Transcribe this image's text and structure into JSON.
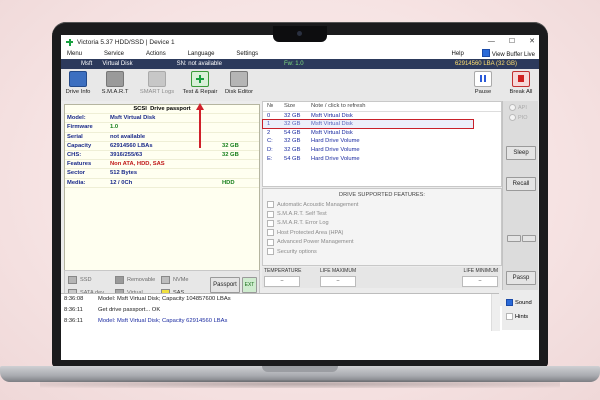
{
  "window": {
    "title": "Victoria 5.37 HDD/SSD | Device 1",
    "controls": [
      "—",
      "☐",
      "✕"
    ]
  },
  "menu": {
    "items": [
      "Menu",
      "Service",
      "Actions",
      "Language",
      "Settings"
    ],
    "help": "Help",
    "view_buffer": "View Buffer Live"
  },
  "status_strip": {
    "model": "Msft",
    "model_name": "Virtual Disk",
    "sn": "SN: not available",
    "fw": "Fw: 1.0",
    "lba": "62914560 LBA (32 GB)"
  },
  "toolbar": {
    "drive_info": "Drive Info",
    "smart": "S.M.A.R.T",
    "smart_logs": "SMART Logs",
    "test_repair": "Test & Repair",
    "disk_editor": "Disk Editor",
    "pause": "Pause",
    "break_all": "Break All"
  },
  "passport": {
    "header_type": "SCSI",
    "header_title": "Drive passport",
    "rows": [
      {
        "key": "Model:",
        "value": "Msft     Virtual Disk",
        "extra": "",
        "color": "#1a2a8a"
      },
      {
        "key": "Firmware",
        "value": "1.0",
        "extra": "",
        "color": "#17801c"
      },
      {
        "key": "Serial",
        "value": "not available",
        "extra": "",
        "color": "#1a2a8a"
      },
      {
        "key": "Capacity",
        "value": "62914560 LBAs",
        "extra": "32 GB",
        "color": "#1a2a8a"
      },
      {
        "key": "CHS:",
        "value": "3916/255/63",
        "extra": "32 GB",
        "color": "#1a2a8a"
      },
      {
        "key": "Features",
        "value": "Non ATA, HDD, SAS",
        "extra": "",
        "color": "#c01818"
      },
      {
        "key": "Sector",
        "value": "512 Bytes",
        "extra": "",
        "color": "#1a2a8a"
      },
      {
        "key": "Media:",
        "value": "12 / 0Ch",
        "extra": "HDD",
        "color": "#1a2a8a"
      }
    ]
  },
  "legend": {
    "ssd": "SSD",
    "removable": "Removable",
    "nvme": "NVMe",
    "sata_dev": "SATA dev",
    "virtual": "Virtual",
    "sas": "SAS",
    "passport_button": "Passport",
    "ext_button": "EXT"
  },
  "disk_table": {
    "headers": [
      "№",
      "Size",
      "Note / click to refresh"
    ],
    "rows": [
      {
        "num": "0",
        "size": "32 GB",
        "note": "Msft     Virtual Disk",
        "selected": false
      },
      {
        "num": "1",
        "size": "32 GB",
        "note": "Msft     Virtual Disk",
        "selected": true
      },
      {
        "num": "2",
        "size": "54 GB",
        "note": "Msft     Virtual Disk",
        "selected": false
      },
      {
        "num": "C:",
        "size": "32 GB",
        "note": "Hard Drive Volume",
        "selected": false
      },
      {
        "num": "D:",
        "size": "32 GB",
        "note": "Hard Drive Volume",
        "selected": false
      },
      {
        "num": "E:",
        "size": "54 GB",
        "note": "Hard Drive Volume",
        "selected": false
      }
    ]
  },
  "features": {
    "title": "DRIVE SUPPORTED FEATURES:",
    "items": [
      "Automatic Acoustic Management",
      "S.M.A.R.T. Self Test",
      "S.M.A.R.T. Error Log",
      "Host Protected Area (HPA)",
      "Advanced Power Management",
      "Security options"
    ]
  },
  "sensors": {
    "temperature": "TEMPERATURE",
    "life_maximum": "LIFE MAXIMUM",
    "life_minimum": "LIFE MINIMUM",
    "dash": "–"
  },
  "right_panel": {
    "api": "API",
    "pio": "PIO",
    "sleep": "Sleep",
    "recall": "Recall",
    "passp": "Passp"
  },
  "log": {
    "rows": [
      {
        "time": "8:36:08",
        "msg": "Model: Msft    Virtual Disk; Capacity 104857600 LBAs",
        "blue": false
      },
      {
        "time": "8:36:11",
        "msg": "Get drive passport... OK",
        "blue": false
      },
      {
        "time": "8:36:11",
        "msg": "Model: Msft    Virtual Disk; Capacity 62914560 LBAs",
        "blue": true
      }
    ]
  },
  "bottom_options": {
    "sound": "Sound",
    "hints": "Hints"
  }
}
